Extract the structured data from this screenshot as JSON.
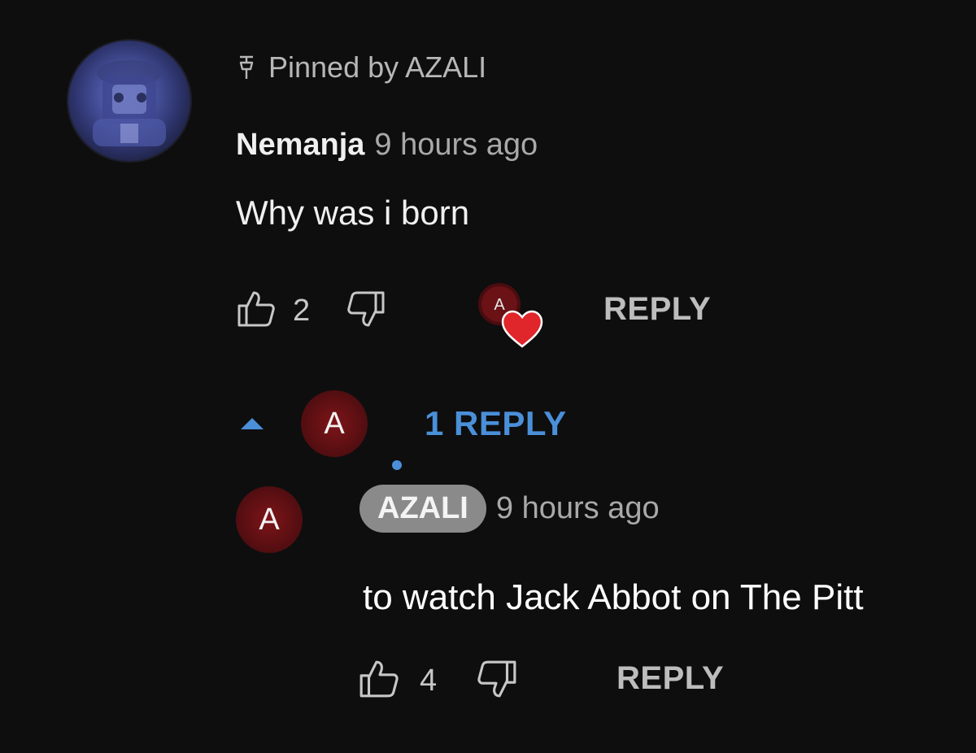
{
  "pinned": {
    "label": "Pinned by AZALI",
    "icon": "pin-icon"
  },
  "comment": {
    "author": "Nemanja",
    "timestamp": "9 hours ago",
    "text": "Why was i born",
    "likes": "2",
    "reply_label": "REPLY",
    "creator_heart_initial": "A"
  },
  "replies_toggle": {
    "avatar_initial": "A",
    "label": "1 REPLY",
    "accent": "#4a8fd8"
  },
  "reply": {
    "avatar_initial": "A",
    "author": "AZALI",
    "timestamp": "9 hours ago",
    "text": "to watch Jack Abbot on The Pitt",
    "likes": "4",
    "reply_label": "REPLY"
  },
  "colors": {
    "background": "#0e0e0f",
    "avatar_red": "#5b0f12",
    "heart_red": "#e0252b",
    "author_badge": "#8a8a8a"
  }
}
